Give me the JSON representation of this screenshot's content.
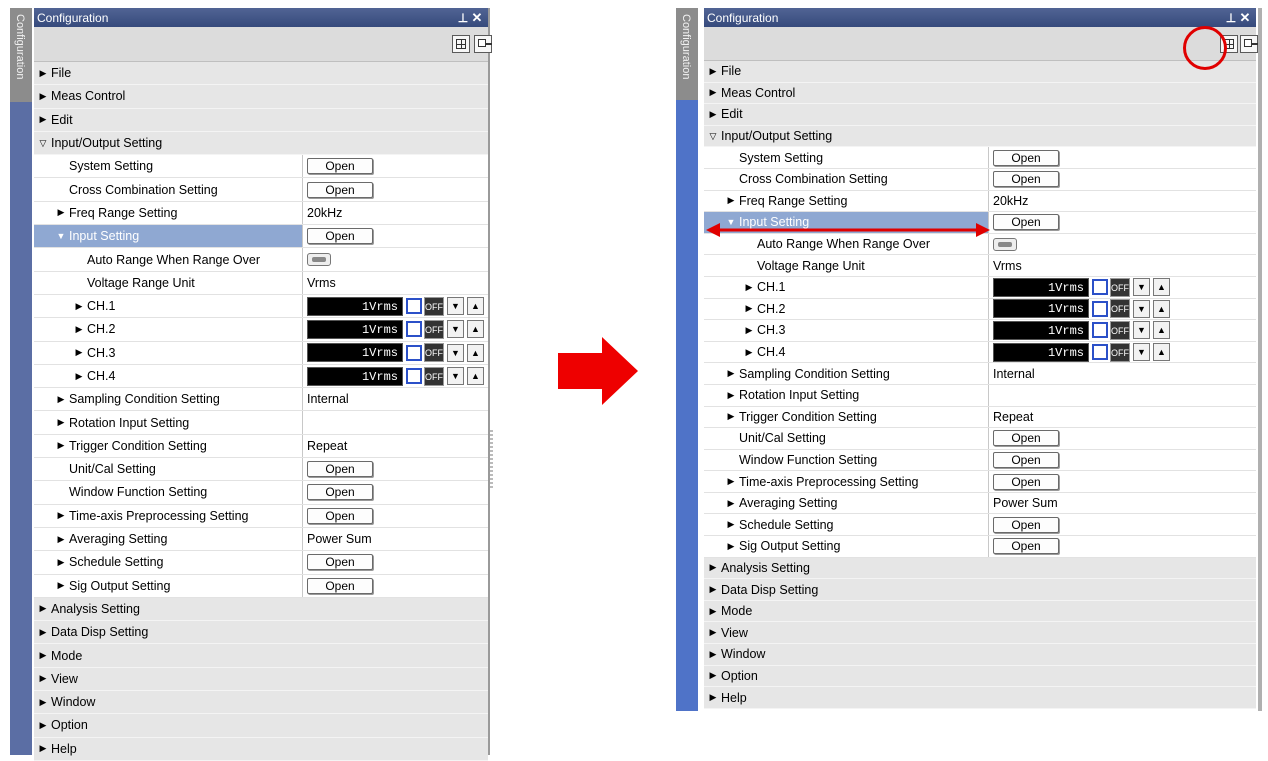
{
  "panel_before": {
    "tab_label": "Configuration",
    "title": "Configuration",
    "pin_glyph": "⊥",
    "close_glyph": "✕",
    "rows": [
      {
        "indent": 0,
        "tri": "▶",
        "label": "File",
        "cat": true
      },
      {
        "indent": 0,
        "tri": "▶",
        "label": "Meas Control",
        "cat": true
      },
      {
        "indent": 0,
        "tri": "▶",
        "label": "Edit",
        "cat": true
      },
      {
        "indent": 0,
        "tri": "▽",
        "label": "Input/Output Setting",
        "cat": true
      },
      {
        "indent": 1,
        "tri": "",
        "label": "System Setting",
        "value": "Open",
        "vtype": "button"
      },
      {
        "indent": 1,
        "tri": "",
        "label": "Cross Combination Setting",
        "value": "Open",
        "vtype": "button"
      },
      {
        "indent": 1,
        "tri": "▶",
        "label": "Freq Range Setting",
        "value": "20kHz",
        "vtype": "text"
      },
      {
        "indent": 1,
        "tri": "▼",
        "label": "Input Setting",
        "value": "Open",
        "vtype": "button",
        "sel": true
      },
      {
        "indent": 2,
        "tri": "",
        "label": "Auto Range When Range Over",
        "vtype": "toggle"
      },
      {
        "indent": 2,
        "tri": "",
        "label": "Voltage Range Unit",
        "value": "Vrms",
        "vtype": "text"
      },
      {
        "indent": 2,
        "tri": "▶",
        "label": "CH.1",
        "value": "1Vrms",
        "off": "OFF",
        "vtype": "channel"
      },
      {
        "indent": 2,
        "tri": "▶",
        "label": "CH.2",
        "value": "1Vrms",
        "off": "OFF",
        "vtype": "channel"
      },
      {
        "indent": 2,
        "tri": "▶",
        "label": "CH.3",
        "value": "1Vrms",
        "off": "OFF",
        "vtype": "channel"
      },
      {
        "indent": 2,
        "tri": "▶",
        "label": "CH.4",
        "value": "1Vrms",
        "off": "OFF",
        "vtype": "channel"
      },
      {
        "indent": 1,
        "tri": "▶",
        "label": "Sampling Condition Setting",
        "value": "Internal",
        "vtype": "text"
      },
      {
        "indent": 1,
        "tri": "▶",
        "label": "Rotation Input Setting",
        "value": "",
        "vtype": "text"
      },
      {
        "indent": 1,
        "tri": "▶",
        "label": "Trigger Condition Setting",
        "value": "Repeat",
        "vtype": "text"
      },
      {
        "indent": 1,
        "tri": "",
        "label": "Unit/Cal Setting",
        "value": "Open",
        "vtype": "button"
      },
      {
        "indent": 1,
        "tri": "",
        "label": "Window Function Setting",
        "value": "Open",
        "vtype": "button"
      },
      {
        "indent": 1,
        "tri": "▶",
        "label": "Time-axis Preprocessing Setting",
        "value": "Open",
        "vtype": "button"
      },
      {
        "indent": 1,
        "tri": "▶",
        "label": "Averaging Setting",
        "value": "Power Sum",
        "vtype": "text"
      },
      {
        "indent": 1,
        "tri": "▶",
        "label": "Schedule Setting",
        "value": "Open",
        "vtype": "button"
      },
      {
        "indent": 1,
        "tri": "▶",
        "label": "Sig Output Setting",
        "value": "Open",
        "vtype": "button"
      },
      {
        "indent": 0,
        "tri": "▶",
        "label": "Analysis Setting",
        "cat": true
      },
      {
        "indent": 0,
        "tri": "▶",
        "label": "Data Disp Setting",
        "cat": true
      },
      {
        "indent": 0,
        "tri": "▶",
        "label": "Mode",
        "cat": true
      },
      {
        "indent": 0,
        "tri": "▶",
        "label": "View",
        "cat": true
      },
      {
        "indent": 0,
        "tri": "▶",
        "label": "Window",
        "cat": true
      },
      {
        "indent": 0,
        "tri": "▶",
        "label": "Option",
        "cat": true
      },
      {
        "indent": 0,
        "tri": "▶",
        "label": "Help",
        "cat": true
      }
    ]
  },
  "panel_after": {
    "tab_label": "Configuration",
    "title": "Configuration",
    "pin_glyph": "⊥",
    "close_glyph": "✕",
    "rows": [
      {
        "indent": 0,
        "tri": "▶",
        "label": "File",
        "cat": true
      },
      {
        "indent": 0,
        "tri": "▶",
        "label": "Meas Control",
        "cat": true
      },
      {
        "indent": 0,
        "tri": "▶",
        "label": "Edit",
        "cat": true
      },
      {
        "indent": 0,
        "tri": "▽",
        "label": "Input/Output Setting",
        "cat": true
      },
      {
        "indent": 1,
        "tri": "",
        "label": "System Setting",
        "value": "Open",
        "vtype": "button"
      },
      {
        "indent": 1,
        "tri": "",
        "label": "Cross Combination Setting",
        "value": "Open",
        "vtype": "button"
      },
      {
        "indent": 1,
        "tri": "▶",
        "label": "Freq Range Setting",
        "value": "20kHz",
        "vtype": "text"
      },
      {
        "indent": 1,
        "tri": "▼",
        "label": "Input Setting",
        "value": "Open",
        "vtype": "button",
        "sel": true
      },
      {
        "indent": 2,
        "tri": "",
        "label": "Auto Range When Range Over",
        "vtype": "toggle"
      },
      {
        "indent": 2,
        "tri": "",
        "label": "Voltage Range Unit",
        "value": "Vrms",
        "vtype": "text"
      },
      {
        "indent": 2,
        "tri": "▶",
        "label": "CH.1",
        "value": "1Vrms",
        "off": "OFF",
        "vtype": "channel"
      },
      {
        "indent": 2,
        "tri": "▶",
        "label": "CH.2",
        "value": "1Vrms",
        "off": "OFF",
        "vtype": "channel"
      },
      {
        "indent": 2,
        "tri": "▶",
        "label": "CH.3",
        "value": "1Vrms",
        "off": "OFF",
        "vtype": "channel"
      },
      {
        "indent": 2,
        "tri": "▶",
        "label": "CH.4",
        "value": "1Vrms",
        "off": "OFF",
        "vtype": "channel"
      },
      {
        "indent": 1,
        "tri": "▶",
        "label": "Sampling Condition Setting",
        "value": "Internal",
        "vtype": "text"
      },
      {
        "indent": 1,
        "tri": "▶",
        "label": "Rotation Input Setting",
        "value": "",
        "vtype": "text"
      },
      {
        "indent": 1,
        "tri": "▶",
        "label": "Trigger Condition Setting",
        "value": "Repeat",
        "vtype": "text"
      },
      {
        "indent": 1,
        "tri": "",
        "label": "Unit/Cal Setting",
        "value": "Open",
        "vtype": "button"
      },
      {
        "indent": 1,
        "tri": "",
        "label": "Window Function Setting",
        "value": "Open",
        "vtype": "button"
      },
      {
        "indent": 1,
        "tri": "▶",
        "label": "Time-axis Preprocessing Setting",
        "value": "Open",
        "vtype": "button"
      },
      {
        "indent": 1,
        "tri": "▶",
        "label": "Averaging Setting",
        "value": "Power Sum",
        "vtype": "text"
      },
      {
        "indent": 1,
        "tri": "▶",
        "label": "Schedule Setting",
        "value": "Open",
        "vtype": "button"
      },
      {
        "indent": 1,
        "tri": "▶",
        "label": "Sig Output Setting",
        "value": "Open",
        "vtype": "button"
      },
      {
        "indent": 0,
        "tri": "▶",
        "label": "Analysis Setting",
        "cat": true
      },
      {
        "indent": 0,
        "tri": "▶",
        "label": "Data Disp Setting",
        "cat": true
      },
      {
        "indent": 0,
        "tri": "▶",
        "label": "Mode",
        "cat": true
      },
      {
        "indent": 0,
        "tri": "▶",
        "label": "View",
        "cat": true
      },
      {
        "indent": 0,
        "tri": "▶",
        "label": "Window",
        "cat": true
      },
      {
        "indent": 0,
        "tri": "▶",
        "label": "Option",
        "cat": true
      },
      {
        "indent": 0,
        "tri": "▶",
        "label": "Help",
        "cat": true
      }
    ]
  },
  "colors": {
    "transition_arrow": "#ee0000",
    "highlight_ring": "#e00000",
    "width_arrow": "#e00000",
    "selected_row": "#8fa8d2",
    "titlebar": "#3f5386"
  },
  "icons": {
    "transition": "right-arrow-icon",
    "expand_all": "grid-expand-icon",
    "collapse_all": "collapse-icon"
  }
}
